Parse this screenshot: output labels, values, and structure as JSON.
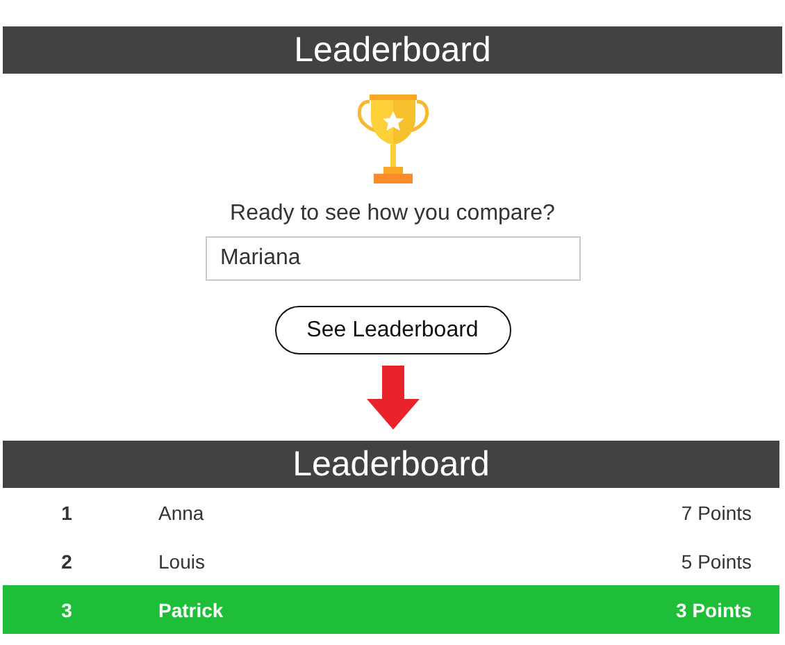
{
  "intro": {
    "title": "Leaderboard",
    "prompt": "Ready to see how you compare?",
    "name_field": {
      "value": "Mariana"
    },
    "button": "See Leaderboard"
  },
  "leaderboard": {
    "title": "Leaderboard",
    "rows": [
      {
        "rank": "1",
        "name": "Anna",
        "points": "7 Points",
        "selected": false
      },
      {
        "rank": "2",
        "name": "Louis",
        "points": "5 Points",
        "selected": false
      },
      {
        "rank": "3",
        "name": "Patrick",
        "points": "3 Points",
        "selected": true
      }
    ]
  }
}
